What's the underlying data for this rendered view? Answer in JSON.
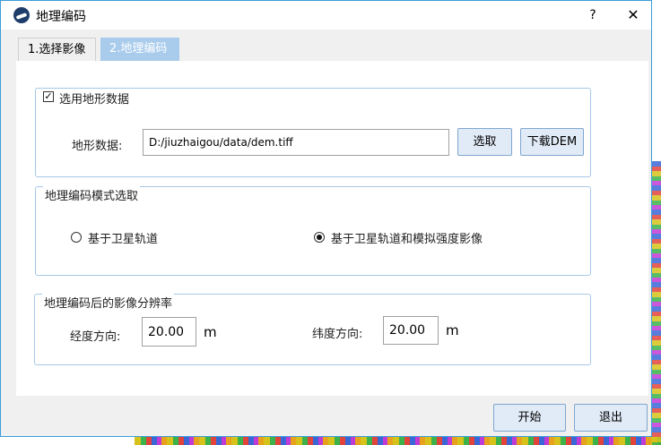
{
  "window": {
    "title": "地理编码",
    "help_label": "?",
    "close_label": "✕"
  },
  "tabs": [
    {
      "label": "1.选择影像",
      "active": true
    },
    {
      "label": "2.地理编码",
      "active": false
    }
  ],
  "terrain_group": {
    "checkbox_label": "选用地形数据",
    "checked": true,
    "check_mark": "✓",
    "field_label": "地形数据:",
    "path_value": "D:/jiuzhaigou/data/dem.tiff",
    "select_button": "选取",
    "download_button": "下载DEM"
  },
  "mode_group": {
    "title": "地理编码模式选取",
    "options": [
      {
        "label": "基于卫星轨道",
        "checked": false
      },
      {
        "label": "基于卫星轨道和模拟强度影像",
        "checked": true
      }
    ]
  },
  "resolution_group": {
    "title": "地理编码后的影像分辨率",
    "lon_label": "经度方向:",
    "lon_value": "20.00",
    "lon_unit": "m",
    "lat_label": "纬度方向:",
    "lat_value": "20.00",
    "lat_unit": "m"
  },
  "footer": {
    "start_button": "开始",
    "exit_button": "退出"
  },
  "colors": {
    "active_tab": "#a9ccec",
    "group_border": "#a6c8e6",
    "button_bg": "#e1ebf7"
  }
}
